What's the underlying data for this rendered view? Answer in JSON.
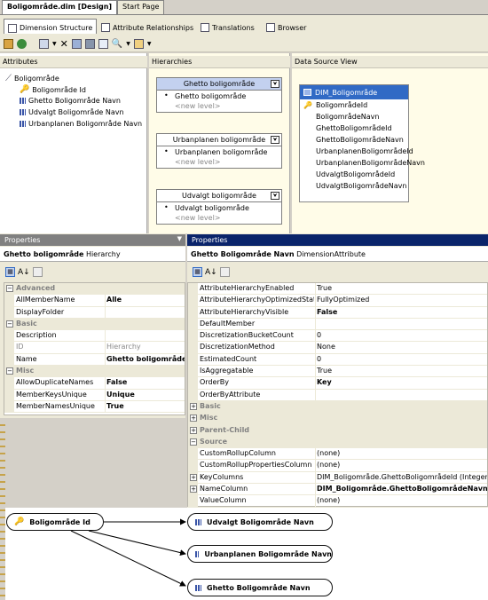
{
  "doc_tabs": [
    "Boligområde.dim [Design]",
    "Start Page"
  ],
  "designer_tabs": [
    "Dimension Structure",
    "Attribute Relationships",
    "Translations",
    "Browser"
  ],
  "panes": {
    "attributes": "Attributes",
    "hierarchies": "Hierarchies",
    "dsv": "Data Source View"
  },
  "attributes": {
    "root": "Boligområde",
    "items": [
      "Boligområde Id",
      "Ghetto Boligområde Navn",
      "Udvalgt Boligområde Navn",
      "Urbanplanen Boligområde Navn"
    ]
  },
  "hierarchies": [
    {
      "name": "Ghetto boligområde",
      "level": "Ghetto boligområde",
      "new_level": "<new level>"
    },
    {
      "name": "Urbanplanen boligområde",
      "level": "Urbanplanen boligområde",
      "new_level": "<new level>"
    },
    {
      "name": "Udvalgt boligområde",
      "level": "Udvalgt boligområde",
      "new_level": "<new level>"
    }
  ],
  "dsv_table": {
    "name": "DIM_Boligområde",
    "columns": [
      "BoligområdeId",
      "BoligområdeNavn",
      "GhettoBoligområdeId",
      "GhettoBoligområdeNavn",
      "UrbanplanenBoligområdeId",
      "UrbanplanenBoligområdeNavn",
      "UdvalgtBoligområdeId",
      "UdvalgtBoligområdeNavn"
    ]
  },
  "props_left": {
    "title": "Properties",
    "object": "Ghetto boligområde",
    "type": "Hierarchy",
    "rows": [
      {
        "cat": "Advanced"
      },
      {
        "n": "AllMemberName",
        "v": "Alle",
        "bold": true
      },
      {
        "n": "DisplayFolder",
        "v": ""
      },
      {
        "cat": "Basic"
      },
      {
        "n": "Description",
        "v": ""
      },
      {
        "n": "ID",
        "v": "Hierarchy",
        "dim": true
      },
      {
        "n": "Name",
        "v": "Ghetto boligområde",
        "bold": true
      },
      {
        "cat": "Misc"
      },
      {
        "n": "AllowDuplicateNames",
        "v": "False",
        "bold": true
      },
      {
        "n": "MemberKeysUnique",
        "v": "Unique",
        "bold": true
      },
      {
        "n": "MemberNamesUnique",
        "v": "True",
        "bold": true
      }
    ]
  },
  "props_right": {
    "title": "Properties",
    "object": "Ghetto Boligområde Navn",
    "type": "DimensionAttribute",
    "rows": [
      {
        "n": "AttributeHierarchyEnabled",
        "v": "True"
      },
      {
        "n": "AttributeHierarchyOptimizedState",
        "v": "FullyOptimized"
      },
      {
        "n": "AttributeHierarchyVisible",
        "v": "False",
        "bold": true
      },
      {
        "n": "DefaultMember",
        "v": ""
      },
      {
        "n": "DiscretizationBucketCount",
        "v": "0"
      },
      {
        "n": "DiscretizationMethod",
        "v": "None"
      },
      {
        "n": "EstimatedCount",
        "v": "0"
      },
      {
        "n": "IsAggregatable",
        "v": "True"
      },
      {
        "n": "OrderBy",
        "v": "Key",
        "bold": true
      },
      {
        "n": "OrderByAttribute",
        "v": ""
      },
      {
        "cat": "Basic",
        "plus": true
      },
      {
        "cat": "Misc",
        "plus": true
      },
      {
        "cat": "Parent-Child",
        "plus": true
      },
      {
        "cat": "Source",
        "minus": true
      },
      {
        "n": "CustomRollupColumn",
        "v": "(none)"
      },
      {
        "n": "CustomRollupPropertiesColumn",
        "v": "(none)"
      },
      {
        "n": "KeyColumns",
        "v": "DIM_Boligområde.GhettoBoligområdeId (Integer)",
        "plus": true
      },
      {
        "n": "NameColumn",
        "v": "DIM_Boligområde.GhettoBoligområdeNavn",
        "bold": true,
        "plus": true
      },
      {
        "n": "ValueColumn",
        "v": "(none)"
      }
    ]
  },
  "diagram": {
    "source": "Boligområde Id",
    "targets": [
      "Udvalgt Boligområde Navn",
      "Urbanplanen Boligområde Navn",
      "Ghetto Boligområde Navn"
    ]
  },
  "colors": {
    "title_active": "#0a246a",
    "title_inactive": "#808080",
    "selection": "#316ac5"
  }
}
